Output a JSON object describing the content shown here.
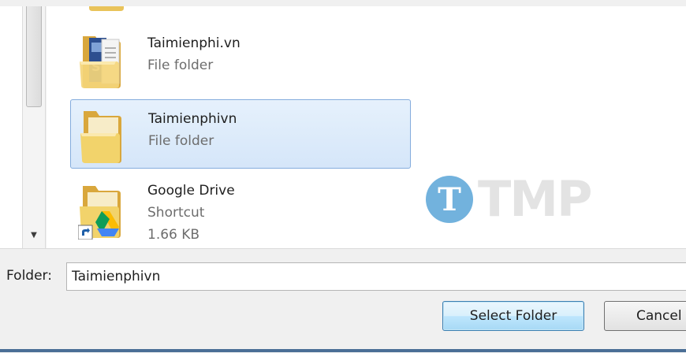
{
  "items": [
    {
      "name": "Taimienphi.vn",
      "type": "File folder",
      "icon": "folder-with-documents-icon"
    },
    {
      "name": "Taimienphivn",
      "type": "File folder",
      "icon": "folder-icon",
      "selected": true
    },
    {
      "name": "Google Drive",
      "type": "Shortcut",
      "size": "1.66 KB",
      "icon": "google-drive-folder-shortcut-icon"
    }
  ],
  "watermark": {
    "text": "TMP",
    "mark": "T"
  },
  "folder": {
    "label": "Folder:",
    "value": "Taimienphivn"
  },
  "buttons": {
    "select": "Select Folder",
    "cancel": "Cancel"
  },
  "colors": {
    "selection_bg": "#d5e6f9",
    "selection_border": "#84acdd",
    "folder_yellow": "#f2d36b",
    "button_accent": "#3c7fb1",
    "window_bottom": "#4a6e96"
  }
}
